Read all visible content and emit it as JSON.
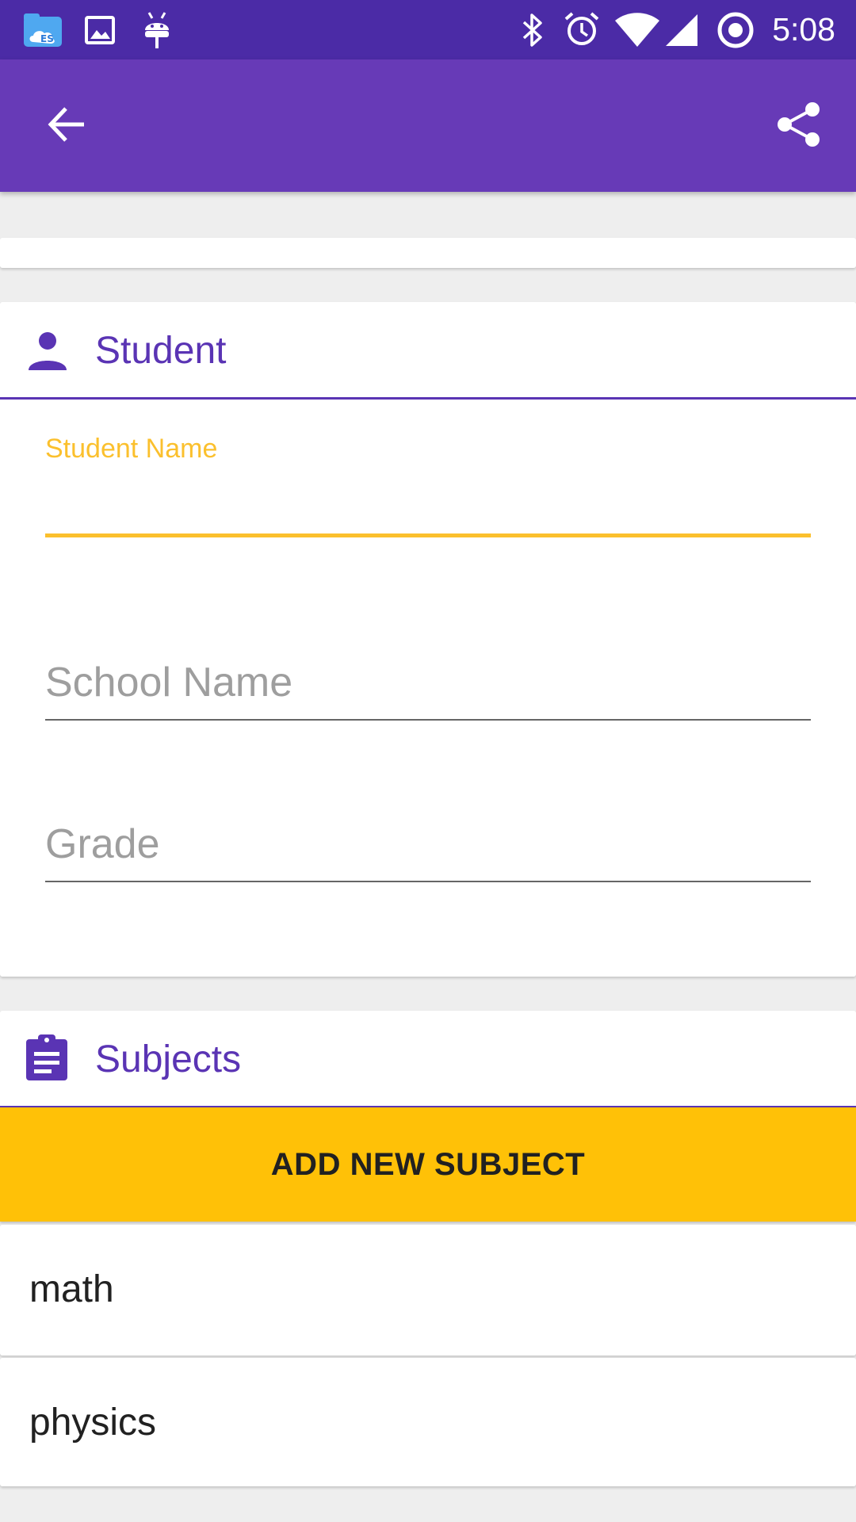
{
  "status_bar": {
    "time": "5:08",
    "left_icons": [
      "file-manager-icon",
      "gallery-icon",
      "android-debug-icon"
    ],
    "right_icons": [
      "bluetooth-icon",
      "alarm-icon",
      "wifi-icon",
      "cellular-signal-icon",
      "sync-icon"
    ]
  },
  "app_bar": {
    "back_icon": "arrow-back-icon",
    "share_icon": "share-icon",
    "background": "#673ab7"
  },
  "student_card": {
    "title": "Student",
    "icon": "person-icon",
    "fields": [
      {
        "label": "Student Name",
        "value": "",
        "placeholder": "",
        "focused": true
      },
      {
        "label": "",
        "value": "",
        "placeholder": "School Name",
        "focused": false
      },
      {
        "label": "",
        "value": "",
        "placeholder": "Grade",
        "focused": false
      }
    ]
  },
  "subjects_card": {
    "title": "Subjects",
    "icon": "assignment-icon",
    "add_button_label": "ADD NEW SUBJECT",
    "items": [
      "math",
      "physics"
    ]
  },
  "colors": {
    "primary": "#673ab7",
    "primary_dark": "#4b2ba6",
    "accent": "#ffc107",
    "header_text": "#5a34b4"
  }
}
